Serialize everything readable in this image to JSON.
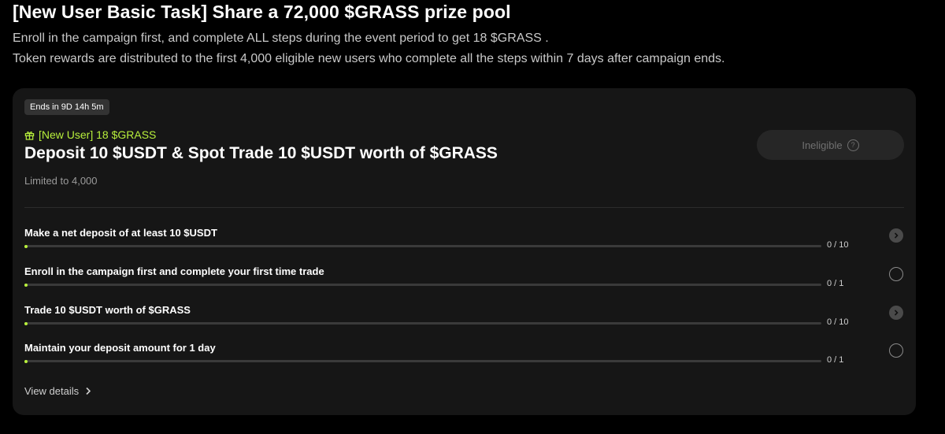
{
  "header": {
    "title": "[New User Basic Task] Share a 72,000 $GRASS prize pool",
    "line1": "Enroll in the campaign first, and complete ALL steps during the event period to get 18 $GRASS .",
    "line2": "Token rewards are distributed to the first 4,000 eligible new users who complete all the steps within 7 days after campaign ends."
  },
  "card": {
    "ends_badge": "Ends in 9D 14h 5m",
    "reward": "[New User] 18 $GRASS",
    "reward_icon": "gift-icon",
    "title": "Deposit 10 $USDT & Spot Trade 10 $USDT worth of $GRASS",
    "limit": "Limited to 4,000",
    "status_button": "Ineligible",
    "status_button_icon": "question-circle-icon",
    "steps": [
      {
        "label": "Make a net deposit of at least 10 $USDT",
        "progress": "0 / 10",
        "progress_fraction": 0,
        "action_icon": "chevron-right-circle-icon"
      },
      {
        "label": "Enroll in the campaign first and complete your first time trade",
        "progress": "0 / 1",
        "progress_fraction": 0,
        "action_icon": "empty-circle-icon"
      },
      {
        "label": "Trade 10 $USDT worth of $GRASS",
        "progress": "0 / 10",
        "progress_fraction": 0,
        "action_icon": "chevron-right-circle-icon"
      },
      {
        "label": "Maintain your deposit amount for 1 day",
        "progress": "0 / 1",
        "progress_fraction": 0,
        "action_icon": "empty-circle-icon"
      }
    ],
    "view_details": "View details"
  },
  "colors": {
    "accent": "#b8f03c",
    "background": "#000000",
    "card": "#161616"
  }
}
